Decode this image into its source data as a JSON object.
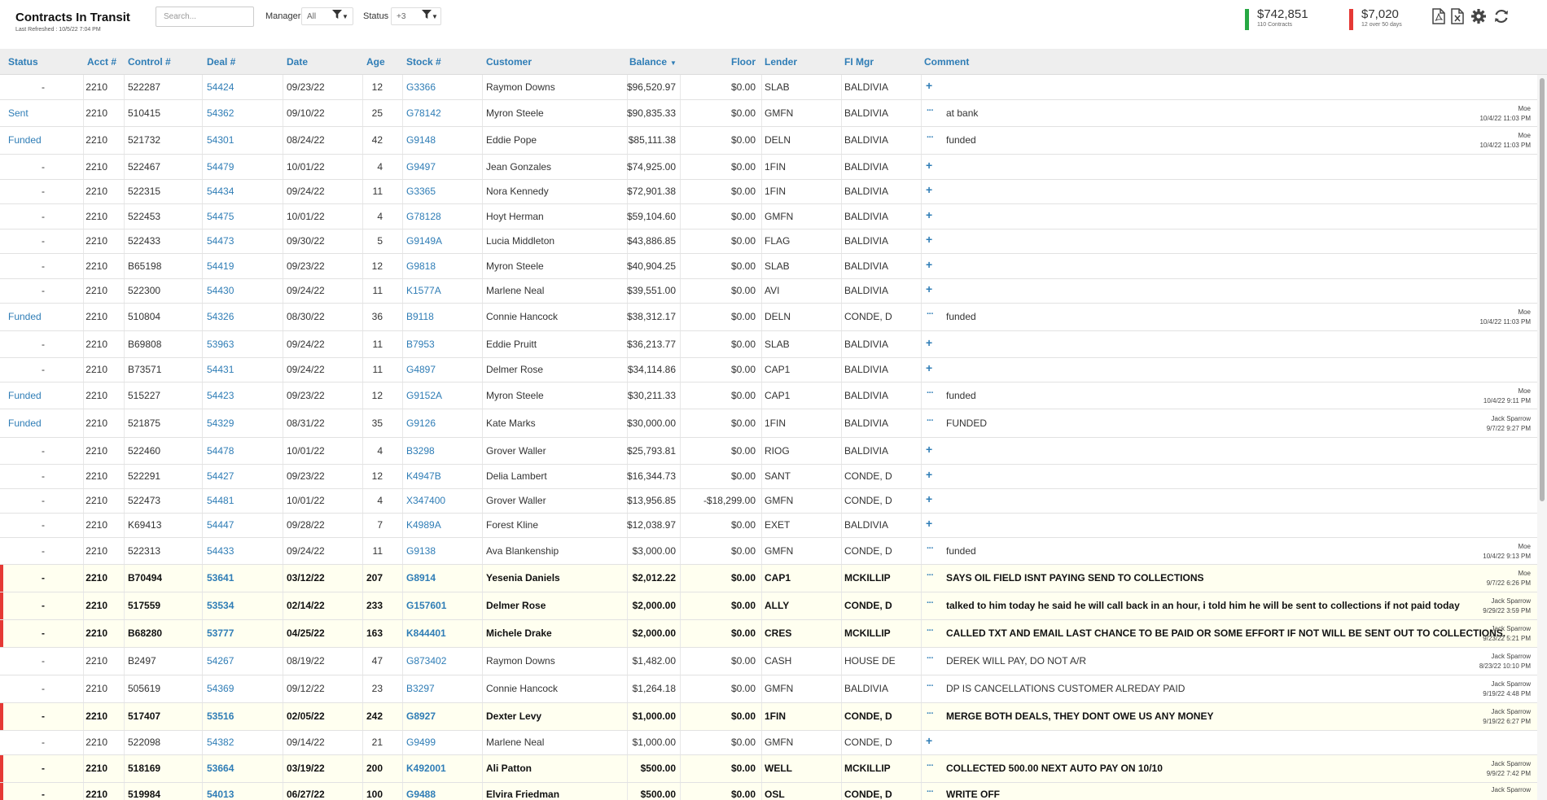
{
  "header": {
    "title": "Contracts In Transit",
    "last_refreshed": "Last Refreshed : 10/5/22 7:04 PM",
    "search_placeholder": "Search...",
    "manager_label": "Manager",
    "manager_value": "All",
    "status_label": "Status",
    "status_value": "+3",
    "stats": [
      {
        "value": "$742,851",
        "sub": "110 Contracts",
        "color": "#27a844"
      },
      {
        "value": "$7,020",
        "sub": "12 over 50 days",
        "color": "#e53935"
      }
    ],
    "icons": [
      "pdf-export-icon",
      "excel-export-icon",
      "gear-icon",
      "refresh-icon"
    ]
  },
  "columns": [
    {
      "key": "status",
      "label": "Status"
    },
    {
      "key": "acct",
      "label": "Acct #"
    },
    {
      "key": "control",
      "label": "Control #"
    },
    {
      "key": "deal",
      "label": "Deal #"
    },
    {
      "key": "date",
      "label": "Date"
    },
    {
      "key": "age",
      "label": "Age"
    },
    {
      "key": "stock",
      "label": "Stock #"
    },
    {
      "key": "customer",
      "label": "Customer"
    },
    {
      "key": "balance",
      "label": "Balance",
      "sorted": "desc"
    },
    {
      "key": "floor",
      "label": "Floor"
    },
    {
      "key": "lender",
      "label": "Lender"
    },
    {
      "key": "fimgr",
      "label": "FI Mgr"
    },
    {
      "key": "comment",
      "label": "Comment"
    }
  ],
  "rows": [
    {
      "status": "-",
      "acct": "2210",
      "control": "522287",
      "deal": "54424",
      "date": "09/23/22",
      "age": "12",
      "stock": "G3366",
      "customer": "Raymon Downs",
      "balance": "$96,520.97",
      "floor": "$0.00",
      "lender": "SLAB",
      "fimgr": "BALDIVIA",
      "comment": "",
      "author": "",
      "ts": "",
      "old": false
    },
    {
      "status": "Sent",
      "acct": "2210",
      "control": "510415",
      "deal": "54362",
      "date": "09/10/22",
      "age": "25",
      "stock": "G78142",
      "customer": "Myron Steele",
      "balance": "$90,835.33",
      "floor": "$0.00",
      "lender": "GMFN",
      "fimgr": "BALDIVIA",
      "comment": "at bank",
      "author": "Moe",
      "ts": "10/4/22 11:03 PM",
      "old": false
    },
    {
      "status": "Funded",
      "acct": "2210",
      "control": "521732",
      "deal": "54301",
      "date": "08/24/22",
      "age": "42",
      "stock": "G9148",
      "customer": "Eddie Pope",
      "balance": "$85,111.38",
      "floor": "$0.00",
      "lender": "DELN",
      "fimgr": "BALDIVIA",
      "comment": "funded",
      "author": "Moe",
      "ts": "10/4/22 11:03 PM",
      "old": false
    },
    {
      "status": "-",
      "acct": "2210",
      "control": "522467",
      "deal": "54479",
      "date": "10/01/22",
      "age": "4",
      "stock": "G9497",
      "customer": "Jean Gonzales",
      "balance": "$74,925.00",
      "floor": "$0.00",
      "lender": "1FIN",
      "fimgr": "BALDIVIA",
      "comment": "",
      "author": "",
      "ts": "",
      "old": false
    },
    {
      "status": "-",
      "acct": "2210",
      "control": "522315",
      "deal": "54434",
      "date": "09/24/22",
      "age": "11",
      "stock": "G3365",
      "customer": "Nora Kennedy",
      "balance": "$72,901.38",
      "floor": "$0.00",
      "lender": "1FIN",
      "fimgr": "BALDIVIA",
      "comment": "",
      "author": "",
      "ts": "",
      "old": false
    },
    {
      "status": "-",
      "acct": "2210",
      "control": "522453",
      "deal": "54475",
      "date": "10/01/22",
      "age": "4",
      "stock": "G78128",
      "customer": "Hoyt Herman",
      "balance": "$59,104.60",
      "floor": "$0.00",
      "lender": "GMFN",
      "fimgr": "BALDIVIA",
      "comment": "",
      "author": "",
      "ts": "",
      "old": false
    },
    {
      "status": "-",
      "acct": "2210",
      "control": "522433",
      "deal": "54473",
      "date": "09/30/22",
      "age": "5",
      "stock": "G9149A",
      "customer": "Lucia Middleton",
      "balance": "$43,886.85",
      "floor": "$0.00",
      "lender": "FLAG",
      "fimgr": "BALDIVIA",
      "comment": "",
      "author": "",
      "ts": "",
      "old": false
    },
    {
      "status": "-",
      "acct": "2210",
      "control": "B65198",
      "deal": "54419",
      "date": "09/23/22",
      "age": "12",
      "stock": "G9818",
      "customer": "Myron Steele",
      "balance": "$40,904.25",
      "floor": "$0.00",
      "lender": "SLAB",
      "fimgr": "BALDIVIA",
      "comment": "",
      "author": "",
      "ts": "",
      "old": false
    },
    {
      "status": "-",
      "acct": "2210",
      "control": "522300",
      "deal": "54430",
      "date": "09/24/22",
      "age": "11",
      "stock": "K1577A",
      "customer": "Marlene Neal",
      "balance": "$39,551.00",
      "floor": "$0.00",
      "lender": "AVI",
      "fimgr": "BALDIVIA",
      "comment": "",
      "author": "",
      "ts": "",
      "old": false
    },
    {
      "status": "Funded",
      "acct": "2210",
      "control": "510804",
      "deal": "54326",
      "date": "08/30/22",
      "age": "36",
      "stock": "B9118",
      "customer": "Connie Hancock",
      "balance": "$38,312.17",
      "floor": "$0.00",
      "lender": "DELN",
      "fimgr": "CONDE, D",
      "comment": "funded",
      "author": "Moe",
      "ts": "10/4/22 11:03 PM",
      "old": false
    },
    {
      "status": "-",
      "acct": "2210",
      "control": "B69808",
      "deal": "53963",
      "date": "09/24/22",
      "age": "11",
      "stock": "B7953",
      "customer": "Eddie Pruitt",
      "balance": "$36,213.77",
      "floor": "$0.00",
      "lender": "SLAB",
      "fimgr": "BALDIVIA",
      "comment": "",
      "author": "",
      "ts": "",
      "old": false
    },
    {
      "status": "-",
      "acct": "2210",
      "control": "B73571",
      "deal": "54431",
      "date": "09/24/22",
      "age": "11",
      "stock": "G4897",
      "customer": "Delmer Rose",
      "balance": "$34,114.86",
      "floor": "$0.00",
      "lender": "CAP1",
      "fimgr": "BALDIVIA",
      "comment": "",
      "author": "",
      "ts": "",
      "old": false
    },
    {
      "status": "Funded",
      "acct": "2210",
      "control": "515227",
      "deal": "54423",
      "date": "09/23/22",
      "age": "12",
      "stock": "G9152A",
      "customer": "Myron Steele",
      "balance": "$30,211.33",
      "floor": "$0.00",
      "lender": "CAP1",
      "fimgr": "BALDIVIA",
      "comment": "funded",
      "author": "Moe",
      "ts": "10/4/22 9:11 PM",
      "old": false
    },
    {
      "status": "Funded",
      "acct": "2210",
      "control": "521875",
      "deal": "54329",
      "date": "08/31/22",
      "age": "35",
      "stock": "G9126",
      "customer": "Kate Marks",
      "balance": "$30,000.00",
      "floor": "$0.00",
      "lender": "1FIN",
      "fimgr": "BALDIVIA",
      "comment": "FUNDED",
      "author": "Jack Sparrow",
      "ts": "9/7/22 9:27 PM",
      "old": false
    },
    {
      "status": "-",
      "acct": "2210",
      "control": "522460",
      "deal": "54478",
      "date": "10/01/22",
      "age": "4",
      "stock": "B3298",
      "customer": "Grover Waller",
      "balance": "$25,793.81",
      "floor": "$0.00",
      "lender": "RIOG",
      "fimgr": "BALDIVIA",
      "comment": "",
      "author": "",
      "ts": "",
      "old": false
    },
    {
      "status": "-",
      "acct": "2210",
      "control": "522291",
      "deal": "54427",
      "date": "09/23/22",
      "age": "12",
      "stock": "K4947B",
      "customer": "Delia Lambert",
      "balance": "$16,344.73",
      "floor": "$0.00",
      "lender": "SANT",
      "fimgr": "CONDE, D",
      "comment": "",
      "author": "",
      "ts": "",
      "old": false
    },
    {
      "status": "-",
      "acct": "2210",
      "control": "522473",
      "deal": "54481",
      "date": "10/01/22",
      "age": "4",
      "stock": "X347400",
      "customer": "Grover Waller",
      "balance": "$13,956.85",
      "floor": "-$18,299.00",
      "lender": "GMFN",
      "fimgr": "CONDE, D",
      "comment": "",
      "author": "",
      "ts": "",
      "old": false
    },
    {
      "status": "-",
      "acct": "2210",
      "control": "K69413",
      "deal": "54447",
      "date": "09/28/22",
      "age": "7",
      "stock": "K4989A",
      "customer": "Forest Kline",
      "balance": "$12,038.97",
      "floor": "$0.00",
      "lender": "EXET",
      "fimgr": "BALDIVIA",
      "comment": "",
      "author": "",
      "ts": "",
      "old": false
    },
    {
      "status": "-",
      "acct": "2210",
      "control": "522313",
      "deal": "54433",
      "date": "09/24/22",
      "age": "11",
      "stock": "G9138",
      "customer": "Ava Blankenship",
      "balance": "$3,000.00",
      "floor": "$0.00",
      "lender": "GMFN",
      "fimgr": "CONDE, D",
      "comment": "funded",
      "author": "Moe",
      "ts": "10/4/22 9:13 PM",
      "old": false
    },
    {
      "status": "-",
      "acct": "2210",
      "control": "B70494",
      "deal": "53641",
      "date": "03/12/22",
      "age": "207",
      "stock": "G8914",
      "customer": "Yesenia Daniels",
      "balance": "$2,012.22",
      "floor": "$0.00",
      "lender": "CAP1",
      "fimgr": "MCKILLIP",
      "comment": "SAYS OIL FIELD ISNT PAYING SEND TO COLLECTIONS",
      "author": "Moe",
      "ts": "9/7/22 6:26 PM",
      "old": true
    },
    {
      "status": "-",
      "acct": "2210",
      "control": "517559",
      "deal": "53534",
      "date": "02/14/22",
      "age": "233",
      "stock": "G157601",
      "customer": "Delmer Rose",
      "balance": "$2,000.00",
      "floor": "$0.00",
      "lender": "ALLY",
      "fimgr": "CONDE, D",
      "comment": "talked to him today he said he will call back in an hour, i told him he will be sent to collections if not paid today",
      "author": "Jack Sparrow",
      "ts": "9/29/22 3:59 PM",
      "old": true
    },
    {
      "status": "-",
      "acct": "2210",
      "control": "B68280",
      "deal": "53777",
      "date": "04/25/22",
      "age": "163",
      "stock": "K844401",
      "customer": "Michele Drake",
      "balance": "$2,000.00",
      "floor": "$0.00",
      "lender": "CRES",
      "fimgr": "MCKILLIP",
      "comment": "CALLED TXT AND EMAIL LAST CHANCE TO BE PAID OR SOME EFFORT IF NOT WILL BE SENT OUT TO COLLECTIONS.",
      "author": "Jack Sparrow",
      "ts": "9/23/22 5:21 PM",
      "old": true
    },
    {
      "status": "-",
      "acct": "2210",
      "control": "B2497",
      "deal": "54267",
      "date": "08/19/22",
      "age": "47",
      "stock": "G873402",
      "customer": "Raymon Downs",
      "balance": "$1,482.00",
      "floor": "$0.00",
      "lender": "CASH",
      "fimgr": "HOUSE DE",
      "comment": "DEREK WILL PAY, DO NOT A/R",
      "author": "Jack Sparrow",
      "ts": "8/23/22 10:10 PM",
      "old": false
    },
    {
      "status": "-",
      "acct": "2210",
      "control": "505619",
      "deal": "54369",
      "date": "09/12/22",
      "age": "23",
      "stock": "B3297",
      "customer": "Connie Hancock",
      "balance": "$1,264.18",
      "floor": "$0.00",
      "lender": "GMFN",
      "fimgr": "BALDIVIA",
      "comment": "DP IS CANCELLATIONS CUSTOMER ALREDAY PAID",
      "author": "Jack Sparrow",
      "ts": "9/19/22 4:48 PM",
      "old": false
    },
    {
      "status": "-",
      "acct": "2210",
      "control": "517407",
      "deal": "53516",
      "date": "02/05/22",
      "age": "242",
      "stock": "G8927",
      "customer": "Dexter Levy",
      "balance": "$1,000.00",
      "floor": "$0.00",
      "lender": "1FIN",
      "fimgr": "CONDE, D",
      "comment": "MERGE BOTH DEALS, THEY DONT OWE US ANY MONEY",
      "author": "Jack Sparrow",
      "ts": "9/19/22 6:27 PM",
      "old": true
    },
    {
      "status": "-",
      "acct": "2210",
      "control": "522098",
      "deal": "54382",
      "date": "09/14/22",
      "age": "21",
      "stock": "G9499",
      "customer": "Marlene Neal",
      "balance": "$1,000.00",
      "floor": "$0.00",
      "lender": "GMFN",
      "fimgr": "CONDE, D",
      "comment": "",
      "author": "",
      "ts": "",
      "old": false
    },
    {
      "status": "-",
      "acct": "2210",
      "control": "518169",
      "deal": "53664",
      "date": "03/19/22",
      "age": "200",
      "stock": "K492001",
      "customer": "Ali Patton",
      "balance": "$500.00",
      "floor": "$0.00",
      "lender": "WELL",
      "fimgr": "MCKILLIP",
      "comment": "COLLECTED 500.00 NEXT AUTO PAY ON 10/10",
      "author": "Jack Sparrow",
      "ts": "9/9/22 7:42 PM",
      "old": true
    },
    {
      "status": "-",
      "acct": "2210",
      "control": "519984",
      "deal": "54013",
      "date": "06/27/22",
      "age": "100",
      "stock": "G9488",
      "customer": "Elvira Friedman",
      "balance": "$500.00",
      "floor": "$0.00",
      "lender": "OSL",
      "fimgr": "CONDE, D",
      "comment": "WRITE OFF",
      "author": "Jack Sparrow",
      "ts": "",
      "old": true
    }
  ]
}
